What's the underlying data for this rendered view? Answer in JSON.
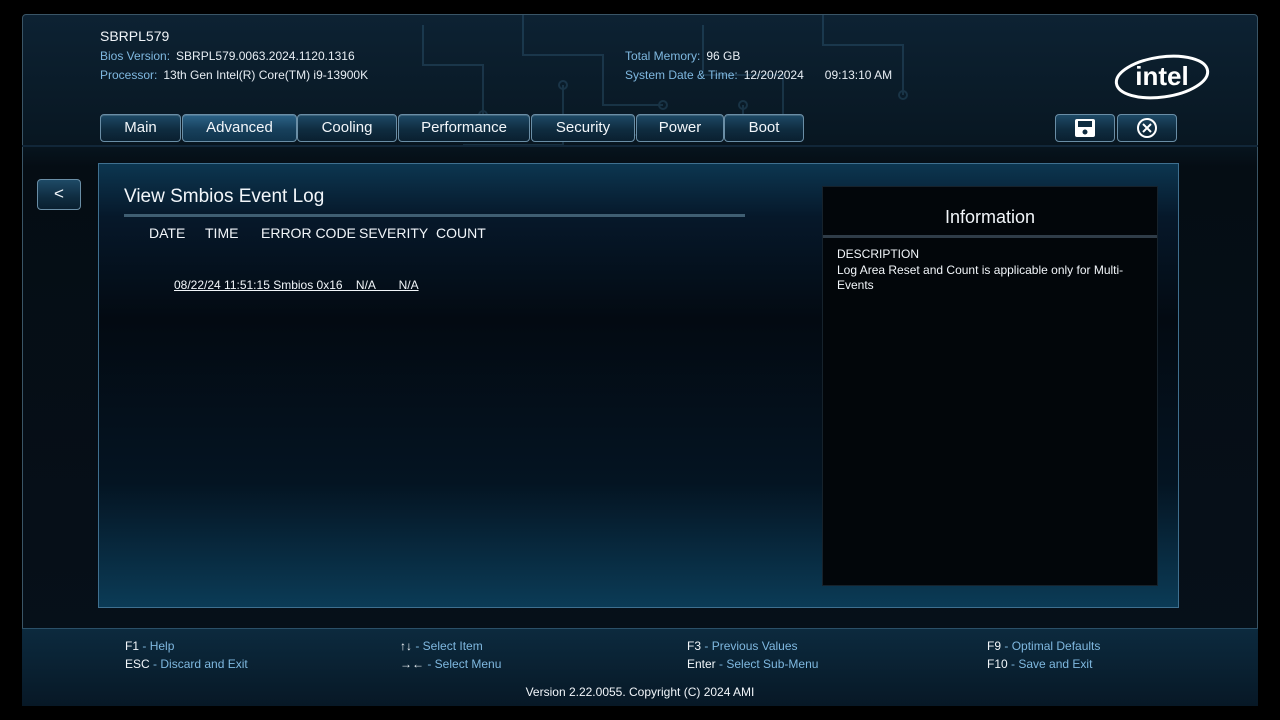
{
  "header": {
    "product": "SBRPL579",
    "bios_version_label": "Bios Version:",
    "bios_version": "SBRPL579.0063.2024.1120.1316",
    "processor_label": "Processor:",
    "processor": "13th Gen Intel(R) Core(TM) i9-13900K",
    "memory_label": "Total Memory:",
    "memory": "96 GB",
    "datetime_label": "System Date & Time:",
    "date": "12/20/2024",
    "time": "09:13:10 AM",
    "logo_text": "intel"
  },
  "tabs": [
    {
      "label": "Main"
    },
    {
      "label": "Advanced",
      "active": true
    },
    {
      "label": "Cooling"
    },
    {
      "label": "Performance"
    },
    {
      "label": "Security"
    },
    {
      "label": "Power"
    },
    {
      "label": "Boot"
    }
  ],
  "toolbar": {
    "save_icon": "save-icon",
    "exit_icon": "close-circle-icon"
  },
  "back_button": {
    "label": "<"
  },
  "main": {
    "title": "View Smbios Event Log",
    "columns": [
      "DATE",
      "TIME",
      "ERROR CODE",
      "SEVERITY",
      "COUNT"
    ],
    "rows": [
      {
        "text": "08/22/24 11:51:15 Smbios 0x16    N/A       N/A"
      }
    ]
  },
  "info": {
    "title": "Information",
    "desc_heading": "DESCRIPTION",
    "desc_text": "Log Area Reset and Count is applicable only for Multi-Events"
  },
  "footer": {
    "keys": [
      {
        "key": "F1",
        "action": "Help"
      },
      {
        "key": "ESC",
        "action": "Discard and Exit"
      },
      {
        "key": "↑↓",
        "action": "Select Item"
      },
      {
        "key": "→←",
        "action": "Select Menu"
      },
      {
        "key": "F3",
        "action": "Previous Values"
      },
      {
        "key": "Enter",
        "action": "Select Sub-Menu"
      },
      {
        "key": "F9",
        "action": "Optimal Defaults"
      },
      {
        "key": "F10",
        "action": "Save and Exit"
      }
    ],
    "copyright": "Version 2.22.0055. Copyright (C) 2024 AMI"
  },
  "colors": {
    "accent_label": "#7fb8e0",
    "text": "#e8eef4",
    "panel_border": "#3f7090"
  }
}
